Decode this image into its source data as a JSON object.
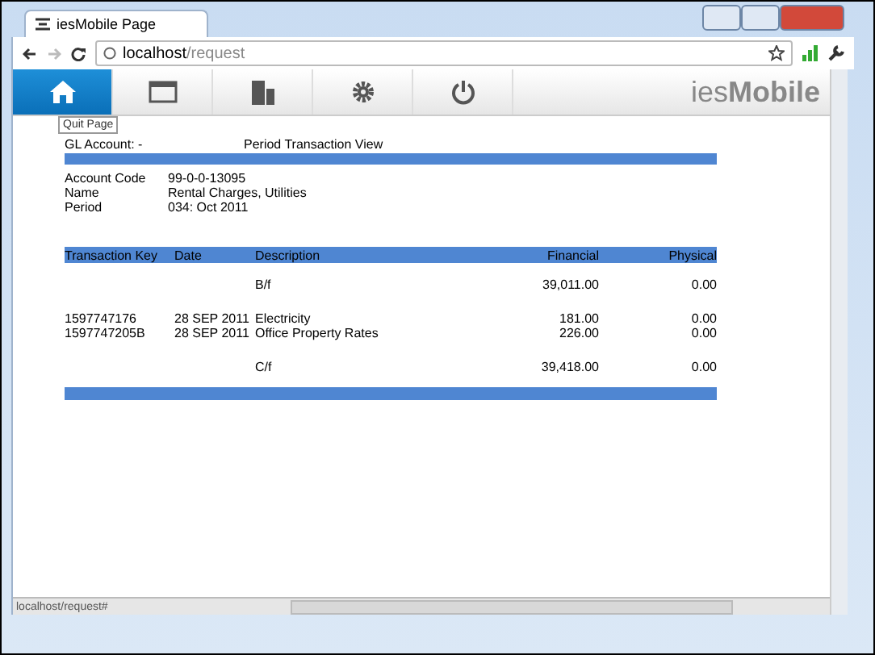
{
  "browser": {
    "tab_title": "iesMobile Page",
    "address_host": "localhost",
    "address_path": "/request",
    "status_url": "localhost/request#"
  },
  "toolbar": {
    "items": [
      {
        "kind": "home",
        "selected": true
      },
      {
        "kind": "window",
        "selected": false
      },
      {
        "kind": "building",
        "selected": false
      },
      {
        "kind": "gear",
        "selected": false
      },
      {
        "kind": "power",
        "selected": false
      }
    ],
    "brand": "ies**Mobile**",
    "tooltip": "Quit Page"
  },
  "report": {
    "gl_account": "GL Account: -",
    "view_title": "Period Transaction View",
    "details": [
      {
        "label": "Account Code",
        "value": "99-0-0-13095"
      },
      {
        "label": "Name",
        "value": "Rental Charges, Utilities"
      },
      {
        "label": "Period",
        "value": "034: Oct 2011"
      }
    ],
    "columns": [
      "Transaction Key",
      "Date",
      "Description",
      "Financial",
      "Physical"
    ],
    "rows": [
      {
        "kind": "balance",
        "description": "B/f",
        "financial": "39,011.00",
        "physical": "0.00"
      },
      {
        "kind": "item",
        "key": "1597747176",
        "date": "28 SEP 2011",
        "description": "Electricity",
        "financial": "181.00",
        "physical": "0.00"
      },
      {
        "kind": "item",
        "key": "1597747205B",
        "date": "28 SEP 2011",
        "description": "Office Property Rates",
        "financial": "226.00",
        "physical": "0.00"
      },
      {
        "kind": "balance",
        "description": "C/f",
        "financial": "39,418.00",
        "physical": "0.00"
      }
    ]
  }
}
